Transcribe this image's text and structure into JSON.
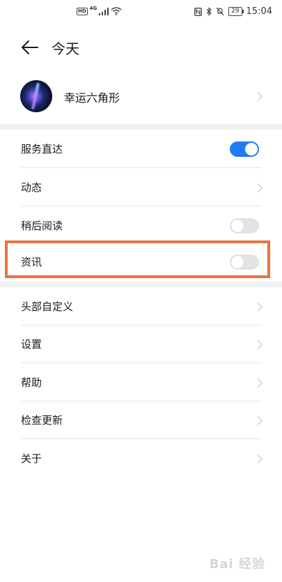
{
  "status_bar": {
    "hd": "HD",
    "network": "4G",
    "battery": "29",
    "time": "15:04"
  },
  "header": {
    "title": "今天"
  },
  "profile": {
    "name": "幸运六角形"
  },
  "settings": [
    {
      "label": "服务直达",
      "control": "toggle",
      "on": true
    },
    {
      "label": "动态",
      "control": "chevron"
    },
    {
      "label": "稍后阅读",
      "control": "toggle",
      "on": false
    },
    {
      "label": "资讯",
      "control": "toggle",
      "on": false,
      "highlighted": true
    }
  ],
  "menu": [
    {
      "label": "头部自定义"
    },
    {
      "label": "设置"
    },
    {
      "label": "帮助"
    },
    {
      "label": "检查更新"
    },
    {
      "label": "关于"
    }
  ],
  "watermark": "Bai 经验",
  "colors": {
    "accent": "#1f7cf2",
    "highlight": "#e8733f"
  }
}
